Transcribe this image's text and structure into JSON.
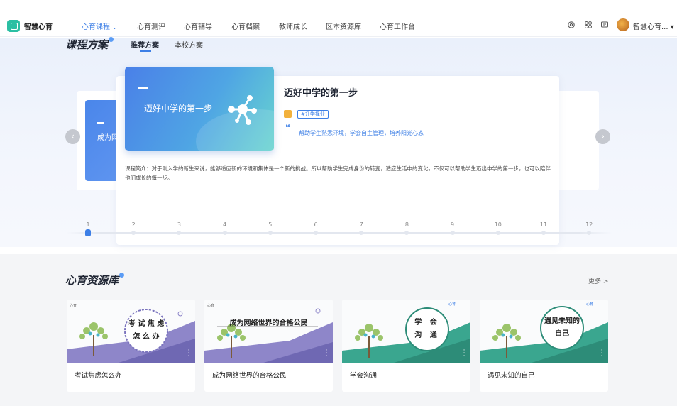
{
  "nav": {
    "logo": "智慧心育",
    "items": [
      {
        "label": "心育课程",
        "active": true
      },
      {
        "label": "心育测评"
      },
      {
        "label": "心育辅导"
      },
      {
        "label": "心育档案"
      },
      {
        "label": "教师成长"
      },
      {
        "label": "区本资源库"
      },
      {
        "label": "心育工作台"
      }
    ],
    "tool_icons": [
      "settings-icon",
      "apps-icon",
      "message-icon"
    ],
    "user_name": "智慧心育... ▾"
  },
  "curriculum": {
    "title": "课程方案",
    "tabs": [
      {
        "label": "推荐方案",
        "active": true
      },
      {
        "label": "本校方案"
      }
    ],
    "side_card_text": "成为网络世界的合格公民",
    "course": {
      "cover_text": "迈好中学的第一步",
      "title": "迈好中学的第一步",
      "tag": "#升学择业",
      "goal": "帮助学生熟悉环境，学会自主管理，培养阳光心态",
      "intro": "课程简介：对于刚入学的新生来说，能够适应新的环境和集体是一个新的挑战。所以帮助学生完成身份的转变，适应生活中的变化，不仅可以帮助学生迈出中学的第一步，也可以陪伴他们成长的每一步。"
    },
    "timeline": [
      "1",
      "2",
      "3",
      "4",
      "5",
      "6",
      "7",
      "8",
      "9",
      "10",
      "11",
      "12"
    ],
    "timeline_active": 1,
    "arrow_prev": "‹",
    "arrow_next": "›"
  },
  "resources": {
    "title": "心育资源库",
    "more": "更多 >",
    "cards": [
      {
        "title": "考试焦虑怎么办",
        "cover_text": "考 试 焦 虑\n怎 么 办",
        "accent": "#8e86c9"
      },
      {
        "title": "成为网络世界的合格公民",
        "cover_text": "成为网络世界的合格公民",
        "accent": "#8e86c9"
      },
      {
        "title": "学会沟通",
        "cover_text": "学 会\n沟 通",
        "accent": "#3aa68f"
      },
      {
        "title": "遇见未知的自己",
        "cover_text": "遇见未知的\n自己",
        "accent": "#3aa68f"
      }
    ]
  },
  "colors": {
    "primary": "#3d7fe6",
    "logo": "#2bbfa3"
  }
}
